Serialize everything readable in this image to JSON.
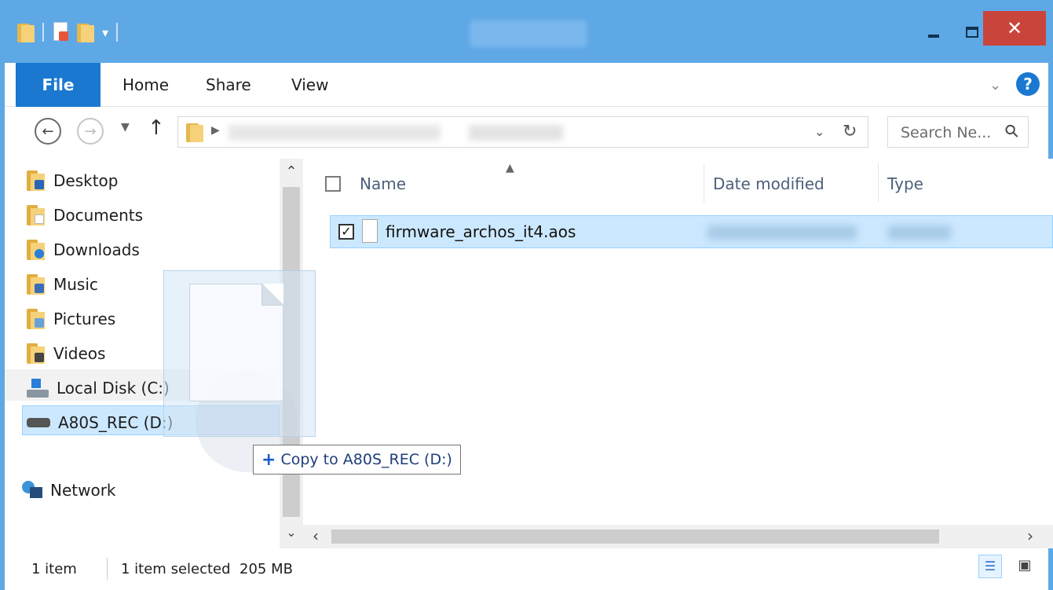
{
  "ribbon": {
    "tabs": [
      {
        "label": "File"
      },
      {
        "label": "Home"
      },
      {
        "label": "Share"
      },
      {
        "label": "View"
      }
    ]
  },
  "search": {
    "placeholder": "Search Ne..."
  },
  "nav_pane": {
    "items": [
      {
        "label": "Desktop",
        "icon": "desktop-folder-icon"
      },
      {
        "label": "Documents",
        "icon": "documents-folder-icon"
      },
      {
        "label": "Downloads",
        "icon": "downloads-folder-icon"
      },
      {
        "label": "Music",
        "icon": "music-folder-icon"
      },
      {
        "label": "Pictures",
        "icon": "pictures-folder-icon"
      },
      {
        "label": "Videos",
        "icon": "videos-folder-icon"
      },
      {
        "label": "Local Disk (C:)",
        "icon": "local-disk-icon"
      },
      {
        "label": "A80S_REC (D:)",
        "icon": "removable-drive-icon"
      },
      {
        "label": "Network",
        "icon": "network-icon"
      }
    ]
  },
  "file_list": {
    "columns": {
      "name": "Name",
      "date": "Date modified",
      "type": "Type"
    },
    "rows": [
      {
        "name": "firmware_archos_it4.aos",
        "checked": true
      }
    ]
  },
  "drag_tooltip": {
    "text": "Copy to A80S_REC (D:)"
  },
  "status": {
    "item_count": "1 item",
    "selection": "1 item selected  205 MB"
  },
  "colors": {
    "titlebar": "#5fa8e6",
    "file_tab": "#1a78d1",
    "close_button": "#c9453c",
    "selection": "#cce8ff"
  }
}
